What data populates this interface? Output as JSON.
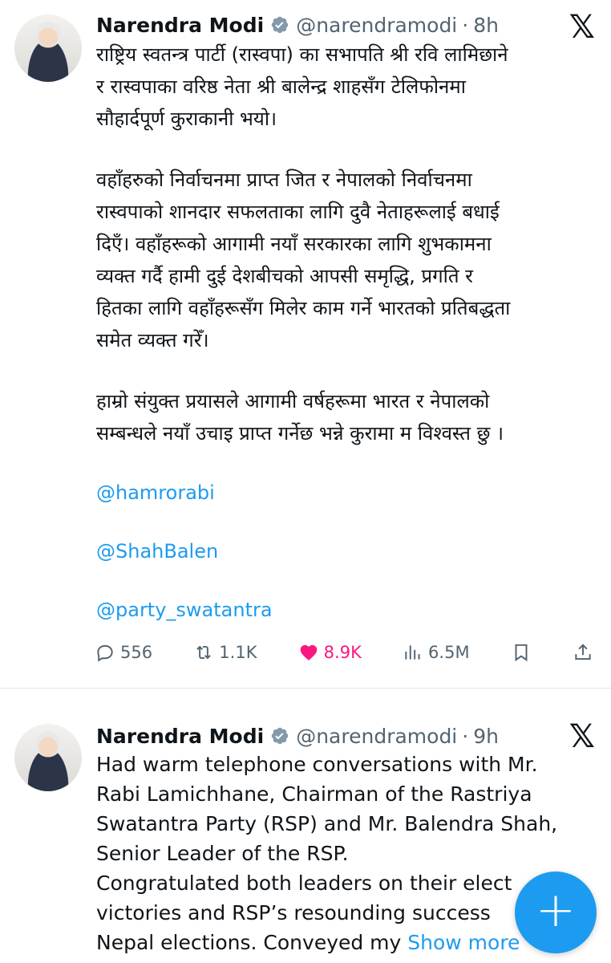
{
  "tweet1": {
    "name": "Narendra Modi",
    "handle": "@narendramodi",
    "separator": "·",
    "time": "8h",
    "paragraphs": [
      [
        "राष्ट्रिय स्वतन्त्र पार्टी (रास्वपा) का सभापति श्री रवि लामिछाने",
        "र  रास्वपाका वरिष्ठ नेता श्री बालेन्द्र शाहसँग टेलिफोनमा",
        "सौहार्दपूर्ण कुराकानी भयो।"
      ],
      [
        "वहाँहरुको निर्वाचनमा प्राप्त जित र नेपालको निर्वाचनमा",
        "रास्वपाको शानदार सफलताका लागि दुवै नेताहरूलाई बधाई",
        "दिएँ। वहाँहरूको आगामी नयाँ सरकारका लागि शुभकामना",
        "व्यक्त गर्दै हामी दुई देशबीचको आपसी समृद्धि, प्रगति र",
        "हितका लागि वहाँहरूसँग मिलेर काम गर्ने भारतको प्रतिबद्धता",
        "समेत व्यक्त गरेँ।"
      ],
      [
        "हाम्रो संयुक्त प्रयासले आगामी वर्षहरूमा भारत र नेपालको",
        "सम्बन्धले नयाँ उचाइ प्राप्त गर्नेछ भन्ने कुरामा म विश्वस्त छु ।"
      ]
    ],
    "mentions": [
      "@hamrorabi",
      "@ShahBalen",
      "@party_swatantra"
    ],
    "stats": {
      "replies": "556",
      "retweets": "1.1K",
      "likes": "8.9K",
      "views": "6.5M"
    }
  },
  "tweet2": {
    "name": "Narendra Modi",
    "handle": "@narendramodi",
    "separator": "·",
    "time": "9h",
    "lines": [
      "Had warm telephone conversations with Mr.",
      "Rabi Lamichhane, Chairman of the Rastriya",
      "Swatantra Party (RSP) and Mr. Balendra Shah,",
      "Senior Leader of the RSP.",
      "Congratulated both leaders on their elect",
      "victories and RSP’s resounding success",
      "Nepal elections. Conveyed my "
    ],
    "show_more": "Show more"
  },
  "icons": {
    "x_logo": "x-logo-icon",
    "verified": "verified-badge-icon",
    "compose": "compose-plus-icon"
  },
  "colors": {
    "accent": "#1d9bf0",
    "like": "#f91880",
    "muted": "#536471",
    "text": "#0f1419"
  }
}
